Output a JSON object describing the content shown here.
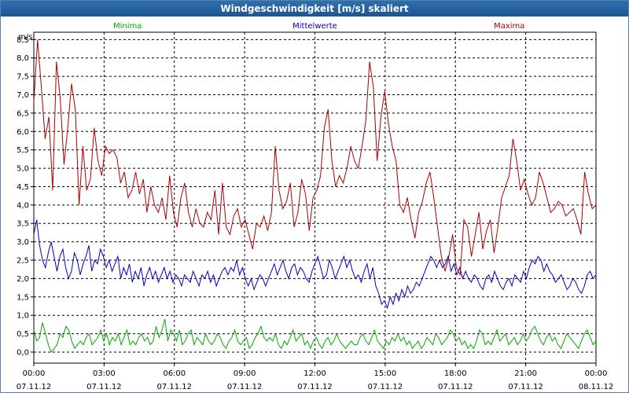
{
  "window": {
    "title": "Windgeschwindigkeit [m/s] skaliert"
  },
  "chart_data": {
    "type": "line",
    "title": "Windgeschwindigkeit [m/s] skaliert",
    "ylabel": "m/s",
    "ylim": [
      -0.3,
      8.7
    ],
    "yticks": [
      "0,0",
      "0,5",
      "1,0",
      "1,5",
      "2,0",
      "2,5",
      "3,0",
      "3,5",
      "4,0",
      "4,5",
      "5,0",
      "5,5",
      "6,0",
      "6,5",
      "7,0",
      "7,5",
      "8,0",
      "8,5"
    ],
    "yvalues": [
      0,
      0.5,
      1,
      1.5,
      2,
      2.5,
      3,
      3.5,
      4,
      4.5,
      5,
      5.5,
      6,
      6.5,
      7,
      7.5,
      8,
      8.5
    ],
    "xlim_hours": [
      0,
      24
    ],
    "xticks": [
      {
        "hour": 0,
        "time": "00:00",
        "date": "07.11.12"
      },
      {
        "hour": 3,
        "time": "03:00",
        "date": "07.11.12"
      },
      {
        "hour": 6,
        "time": "06:00",
        "date": "07.11.12"
      },
      {
        "hour": 9,
        "time": "09:00",
        "date": "07.11.12"
      },
      {
        "hour": 12,
        "time": "12:00",
        "date": "07.11.12"
      },
      {
        "hour": 15,
        "time": "15:00",
        "date": "07.11.12"
      },
      {
        "hour": 18,
        "time": "18:00",
        "date": "07.11.12"
      },
      {
        "hour": 21,
        "time": "21:00",
        "date": "07.11.12"
      },
      {
        "hour": 24,
        "time": "00:00",
        "date": "08.11.12"
      }
    ],
    "grid": true,
    "legend_position": "top",
    "series": [
      {
        "name": "Minima",
        "color": "#00aa00",
        "values": [
          0.6,
          0.3,
          0.4,
          0.8,
          0.5,
          0.2,
          0.0,
          0.1,
          0.2,
          0.5,
          0.4,
          0.7,
          0.6,
          0.3,
          0.1,
          0.2,
          0.3,
          0.2,
          0.4,
          0.5,
          0.2,
          0.3,
          0.4,
          0.6,
          0.3,
          0.5,
          0.2,
          0.4,
          0.3,
          0.5,
          0.2,
          0.4,
          0.6,
          0.2,
          0.3,
          0.2,
          0.4,
          0.5,
          0.3,
          0.4,
          0.2,
          0.3,
          0.7,
          0.4,
          0.6,
          0.9,
          0.3,
          0.6,
          0.5,
          0.3,
          0.6,
          0.2,
          0.3,
          0.5,
          0.6,
          0.2,
          0.4,
          0.3,
          0.2,
          0.5,
          0.3,
          0.2,
          0.3,
          0.5,
          0.4,
          0.2,
          0.1,
          0.3,
          0.4,
          0.6,
          0.3,
          0.2,
          0.3,
          0.4,
          0.1,
          0.2,
          0.4,
          0.5,
          0.7,
          0.4,
          0.3,
          0.4,
          0.3,
          0.5,
          0.2,
          0.1,
          0.3,
          0.2,
          0.4,
          0.6,
          0.3,
          0.4,
          0.5,
          0.2,
          0.3,
          0.1,
          0.3,
          0.4,
          0.2,
          0.1,
          0.3,
          0.4,
          0.2,
          0.3,
          0.5,
          0.3,
          0.2,
          0.1,
          0.2,
          0.3,
          0.2,
          0.2,
          0.4,
          0.5,
          0.3,
          0.2,
          0.4,
          0.6,
          0.3,
          0.2,
          0.1,
          0.3,
          0.2,
          0.4,
          0.3,
          0.5,
          0.3,
          0.4,
          0.2,
          0.3,
          0.1,
          0.2,
          0.3,
          0.1,
          0.2,
          0.4,
          0.3,
          0.2,
          0.5,
          0.4,
          0.2,
          0.3,
          0.4,
          0.6,
          0.5,
          0.3,
          0.4,
          0.2,
          0.3,
          0.1,
          0.2,
          0.1,
          0.3,
          0.6,
          0.5,
          0.2,
          0.3,
          0.2,
          0.4,
          0.6,
          0.3,
          0.4,
          0.5,
          0.2,
          0.3,
          0.4,
          0.2,
          0.3,
          0.5,
          0.3,
          0.4,
          0.6,
          0.7,
          0.5,
          0.3,
          0.2,
          0.4,
          0.5,
          0.3,
          0.4,
          0.2,
          0.1,
          0.3,
          0.5,
          0.4,
          0.3,
          0.2,
          0.1,
          0.3,
          0.5,
          0.6,
          0.4,
          0.2,
          0.3
        ]
      },
      {
        "name": "Mittelwerte",
        "color": "#0000bb",
        "values": [
          3.2,
          3.6,
          2.9,
          2.5,
          2.3,
          2.7,
          3.0,
          2.6,
          2.2,
          2.6,
          2.8,
          2.3,
          2.0,
          2.2,
          2.7,
          2.5,
          2.1,
          2.4,
          2.6,
          2.9,
          2.2,
          2.5,
          2.4,
          2.8,
          2.6,
          2.3,
          2.5,
          2.2,
          2.4,
          2.6,
          2.0,
          2.3,
          2.1,
          2.4,
          1.9,
          2.2,
          2.0,
          2.3,
          1.8,
          2.1,
          2.3,
          2.0,
          2.2,
          1.9,
          2.1,
          2.3,
          2.0,
          2.2,
          1.9,
          2.1,
          2.0,
          1.8,
          2.1,
          2.0,
          1.9,
          2.2,
          2.0,
          1.8,
          2.1,
          2.0,
          2.2,
          1.9,
          2.1,
          1.8,
          2.0,
          2.2,
          2.3,
          2.1,
          2.3,
          2.2,
          2.5,
          2.1,
          2.3,
          2.0,
          1.8,
          2.0,
          1.7,
          1.9,
          2.1,
          2.0,
          1.8,
          2.0,
          2.2,
          2.4,
          2.1,
          2.3,
          2.5,
          2.2,
          2.0,
          2.3,
          2.4,
          2.1,
          2.3,
          2.2,
          2.0,
          1.9,
          2.2,
          2.4,
          2.6,
          2.3,
          2.0,
          2.1,
          2.5,
          2.3,
          2.0,
          2.2,
          2.4,
          2.6,
          2.3,
          2.5,
          2.2,
          2.0,
          2.1,
          1.9,
          2.2,
          2.4,
          2.0,
          2.3,
          1.8,
          1.6,
          1.3,
          1.4,
          1.2,
          1.5,
          1.3,
          1.6,
          1.4,
          1.7,
          1.5,
          1.8,
          1.6,
          1.7,
          1.9,
          1.8,
          2.0,
          2.2,
          2.4,
          2.6,
          2.5,
          2.3,
          2.5,
          2.3,
          2.4,
          2.6,
          2.2,
          2.4,
          2.1,
          2.3,
          2.0,
          2.2,
          2.0,
          1.9,
          2.1,
          2.0,
          1.8,
          1.7,
          2.0,
          2.1,
          1.9,
          2.2,
          2.0,
          1.8,
          1.7,
          1.9,
          2.0,
          1.8,
          2.1,
          2.0,
          1.9,
          2.2,
          2.0,
          2.3,
          2.5,
          2.4,
          2.6,
          2.5,
          2.2,
          2.4,
          2.2,
          2.1,
          1.9,
          2.0,
          2.1,
          1.9,
          1.7,
          1.8,
          2.0,
          1.9,
          1.7,
          1.6,
          1.8,
          2.1,
          2.2,
          2.0,
          2.1
        ]
      },
      {
        "name": "Maxima",
        "color": "#aa0000",
        "values": [
          6.8,
          8.5,
          7.2,
          5.8,
          6.4,
          4.4,
          7.9,
          6.9,
          5.1,
          6.1,
          7.3,
          6.6,
          4.0,
          5.6,
          4.4,
          4.7,
          6.1,
          5.2,
          4.8,
          5.6,
          5.4,
          5.5,
          5.3,
          4.6,
          4.9,
          4.2,
          4.4,
          4.9,
          4.3,
          4.7,
          3.8,
          4.5,
          4.0,
          3.8,
          4.2,
          3.6,
          4.8,
          3.8,
          3.4,
          4.2,
          4.6,
          3.8,
          3.4,
          3.9,
          3.5,
          3.4,
          3.8,
          3.6,
          4.4,
          3.2,
          4.6,
          3.4,
          3.2,
          3.7,
          3.9,
          3.4,
          3.6,
          3.2,
          2.8,
          3.5,
          3.4,
          3.7,
          3.3,
          3.8,
          5.6,
          4.4,
          3.9,
          4.1,
          4.6,
          3.4,
          3.8,
          4.7,
          4.3,
          3.3,
          4.2,
          4.4,
          4.8,
          6.1,
          6.6,
          5.2,
          4.5,
          4.8,
          4.6,
          5.0,
          5.6,
          5.2,
          5.0,
          5.6,
          6.3,
          7.9,
          7.2,
          5.2,
          6.4,
          7.1,
          6.2,
          5.6,
          5.2,
          4.0,
          3.8,
          4.2,
          3.6,
          3.1,
          3.8,
          4.1,
          4.6,
          4.9,
          4.2,
          3.4,
          2.6,
          2.2,
          2.6,
          3.2,
          2.3,
          2.1,
          3.6,
          3.4,
          2.6,
          3.2,
          3.8,
          2.8,
          3.3,
          3.6,
          2.7,
          3.4,
          4.2,
          4.5,
          4.8,
          5.8,
          5.2,
          4.4,
          4.7,
          4.3,
          4.0,
          4.2,
          4.9,
          4.6,
          4.2,
          3.8,
          3.9,
          4.1,
          4.0,
          3.7,
          3.8,
          3.9,
          3.6,
          3.2,
          4.9,
          4.3,
          3.9,
          4.0
        ]
      }
    ]
  }
}
